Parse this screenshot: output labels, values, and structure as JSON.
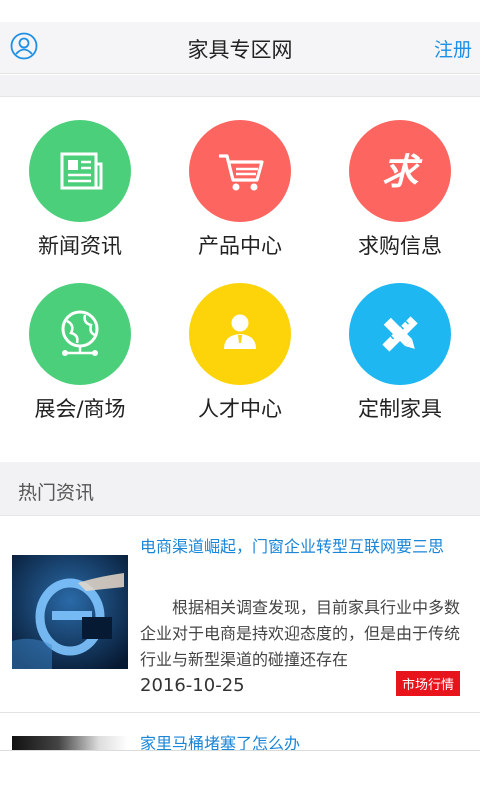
{
  "header": {
    "title": "家具专区网",
    "register": "注册"
  },
  "grid": [
    {
      "label": "新闻资讯",
      "icon": "news-icon",
      "color": "#4ccf7b"
    },
    {
      "label": "产品中心",
      "icon": "cart-icon",
      "color": "#fc6560"
    },
    {
      "label": "求购信息",
      "icon": "qiu-icon",
      "color": "#fc6560",
      "glyph": "求"
    },
    {
      "label": "展会/商场",
      "icon": "globe-network-icon",
      "color": "#4ccf7b"
    },
    {
      "label": "人才中心",
      "icon": "person-icon",
      "color": "#fcd409"
    },
    {
      "label": "定制家具",
      "icon": "pencil-ruler-icon",
      "color": "#1eb7f2"
    }
  ],
  "section": {
    "title": "热门资讯"
  },
  "news": [
    {
      "title": "电商渠道崛起，门窗企业转型互联网要三思",
      "summary": "根据相关调查发现，目前家具行业中多数企业对于电商是持欢迎态度的，但是由于传统行业与新型渠道的碰撞还存在",
      "date": "2016-10-25",
      "tag": "市场行情"
    },
    {
      "title": "家里马桶堵塞了怎么办"
    }
  ]
}
